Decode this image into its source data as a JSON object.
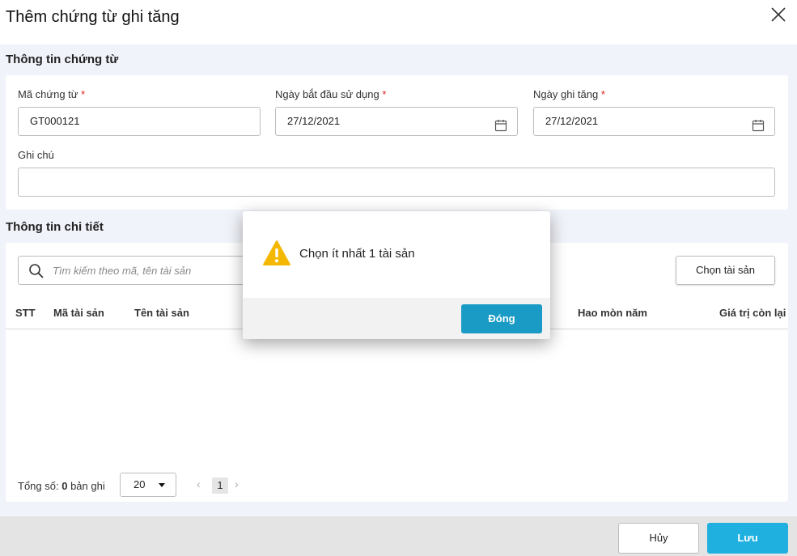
{
  "window": {
    "title": "Thêm chứng từ ghi tăng"
  },
  "voucher_section": {
    "title": "Thông tin chứng từ",
    "code_label": "Mã chứng từ",
    "code_value": "GT000121",
    "start_date_label": "Ngày bắt đầu sử dụng",
    "start_date_value": "27/12/2021",
    "increase_date_label": "Ngày ghi tăng",
    "increase_date_value": "27/12/2021",
    "note_label": "Ghi chú",
    "note_value": "",
    "required_mark": "*"
  },
  "detail_section": {
    "title": "Thông tin chi tiết",
    "search_placeholder": "Tìm kiếm theo mã, tên tài sản",
    "choose_button": "Chọn tài sản",
    "columns": [
      "STT",
      "Mã tài sản",
      "Tên tài sản",
      "Hao mòn năm",
      "Giá trị còn lại"
    ],
    "rows": []
  },
  "pagination": {
    "total_prefix": "Tổng số:",
    "total_count": "0",
    "total_suffix": "bản ghi",
    "page_size": "20",
    "prev": "‹",
    "current_page": "1",
    "next": "›"
  },
  "actions": {
    "cancel": "Hủy",
    "save": "Lưu"
  },
  "dialog": {
    "message": "Chọn ít nhất 1 tài sản",
    "close_button": "Đóng"
  },
  "colors": {
    "primary": "#1fb0e0",
    "dialog_button": "#1a9bc6",
    "warning": "#f5b800",
    "required": "#e02020",
    "background": "#f1f3fa"
  },
  "icons": {
    "close": "close-icon",
    "calendar": "calendar-icon",
    "search": "search-icon",
    "warning": "warning-icon"
  }
}
